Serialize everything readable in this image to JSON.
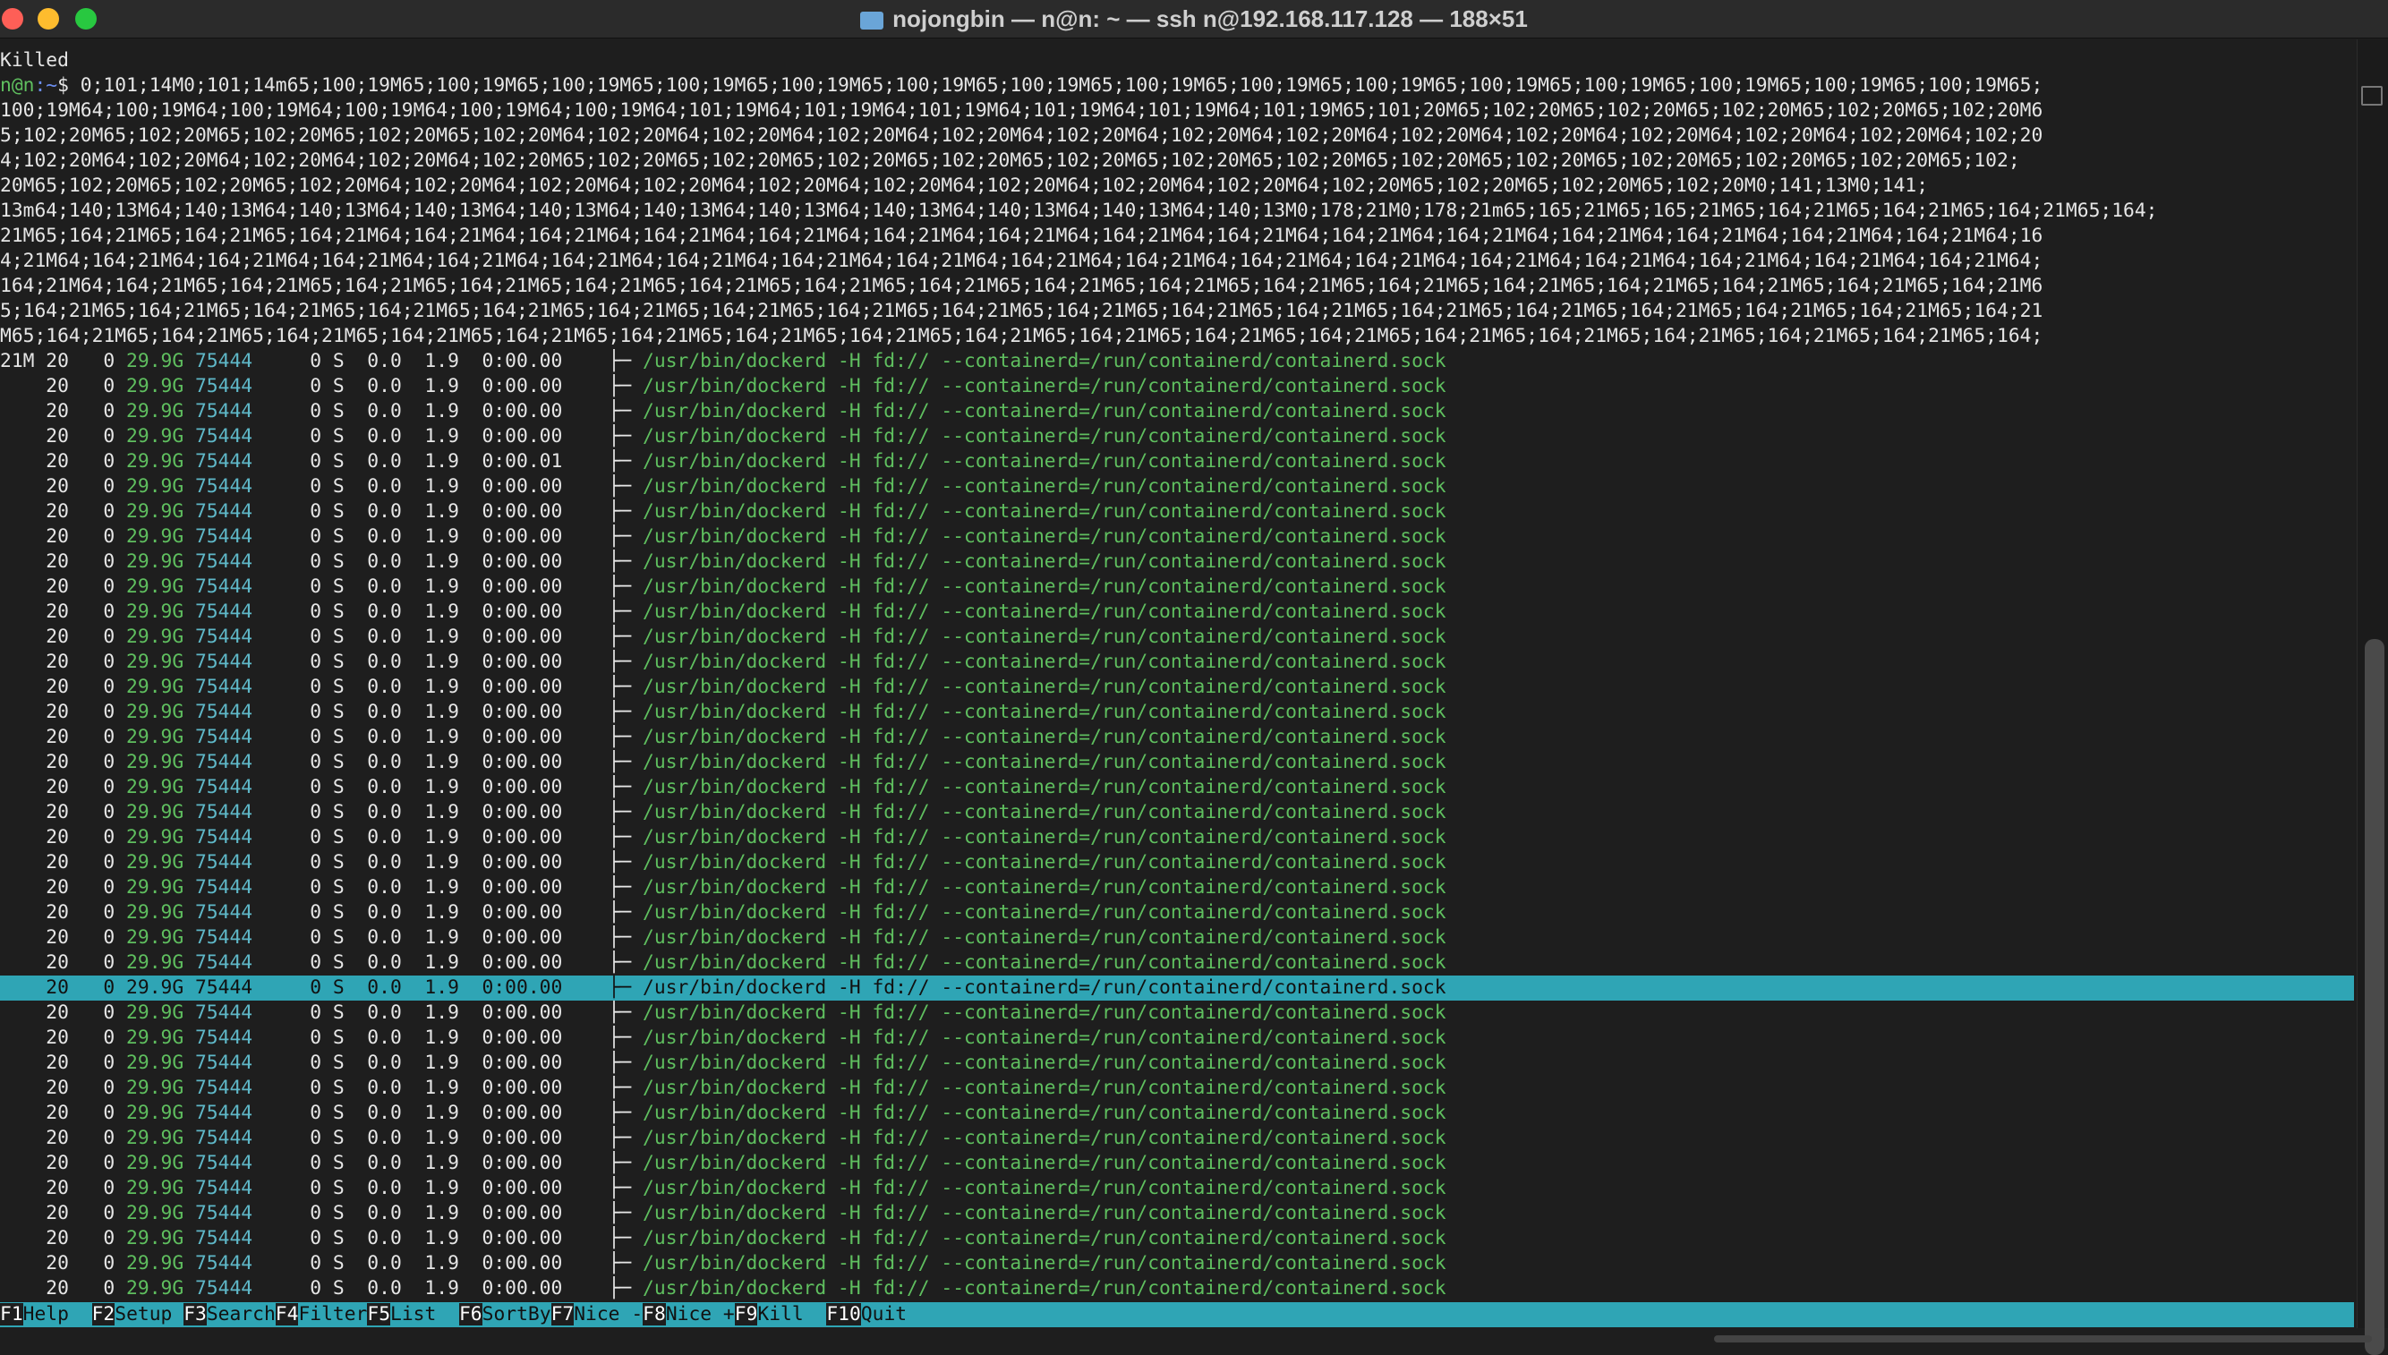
{
  "window": {
    "title": "nojongbin — n@n: ~ — ssh n@192.168.117.128 — 188×51"
  },
  "terminal": {
    "killed": "Killed",
    "prompt_user": "n@n",
    "prompt_path": ":~",
    "prompt_symbol": "$ ",
    "command_lines": [
      "0;101;14M0;101;14m65;100;19M65;100;19M65;100;19M65;100;19M65;100;19M65;100;19M65;100;19M65;100;19M65;100;19M65;100;19M65;100;19M65;100;19M65;100;19M65;100;19M65;100;19M65;",
      "100;19M64;100;19M64;100;19M64;100;19M64;100;19M64;100;19M64;101;19M64;101;19M64;101;19M64;101;19M64;101;19M64;101;19M65;101;20M65;102;20M65;102;20M65;102;20M65;102;20M65;102;20M6",
      "5;102;20M65;102;20M65;102;20M65;102;20M65;102;20M64;102;20M64;102;20M64;102;20M64;102;20M64;102;20M64;102;20M64;102;20M64;102;20M64;102;20M64;102;20M64;102;20M64;102;20M64;102;20",
      "4;102;20M64;102;20M64;102;20M64;102;20M64;102;20M65;102;20M65;102;20M65;102;20M65;102;20M65;102;20M65;102;20M65;102;20M65;102;20M65;102;20M65;102;20M65;102;20M65;102;20M65;102;",
      "20M65;102;20M65;102;20M65;102;20M64;102;20M64;102;20M64;102;20M64;102;20M64;102;20M64;102;20M64;102;20M64;102;20M64;102;20M65;102;20M65;102;20M65;102;20M0;141;13M0;141;",
      "13m64;140;13M64;140;13M64;140;13M64;140;13M64;140;13M64;140;13M64;140;13M64;140;13M64;140;13M64;140;13M64;140;13M0;178;21M0;178;21m65;165;21M65;165;21M65;164;21M65;164;21M65;164;21M65;164;",
      "21M65;164;21M65;164;21M65;164;21M64;164;21M64;164;21M64;164;21M64;164;21M64;164;21M64;164;21M64;164;21M64;164;21M64;164;21M64;164;21M64;164;21M64;164;21M64;164;21M64;164;21M64;16",
      "4;21M64;164;21M64;164;21M64;164;21M64;164;21M64;164;21M64;164;21M64;164;21M64;164;21M64;164;21M64;164;21M64;164;21M64;164;21M64;164;21M64;164;21M64;164;21M64;164;21M64;164;21M64;",
      "164;21M64;164;21M65;164;21M65;164;21M65;164;21M65;164;21M65;164;21M65;164;21M65;164;21M65;164;21M65;164;21M65;164;21M65;164;21M65;164;21M65;164;21M65;164;21M65;164;21M65;164;21M6",
      "5;164;21M65;164;21M65;164;21M65;164;21M65;164;21M65;164;21M65;164;21M65;164;21M65;164;21M65;164;21M65;164;21M65;164;21M65;164;21M65;164;21M65;164;21M65;164;21M65;164;21M65;164;21",
      "M65;164;21M65;164;21M65;164;21M65;164;21M65;164;21M65;164;21M65;164;21M65;164;21M65;164;21M65;164;21M65;164;21M65;164;21M65;164;21M65;164;21M65;164;21M65;164;21M65;164;21M65;164;"
    ],
    "first_row_prefix": "21M",
    "process": {
      "pri": "20",
      "ni": "0",
      "virt": "29.9G",
      "res": "75444",
      "shr": "0",
      "state": "S",
      "cpu": "0.0",
      "mem": "1.9",
      "time": "0:00.00",
      "time_alt": "0:00.01",
      "tree": "├─",
      "command": "/usr/bin/dockerd -H fd:// --containerd=/run/containerd/containerd.sock"
    },
    "selected_row_index": 25
  },
  "function_bar": [
    {
      "key": "F1",
      "label": "Help  "
    },
    {
      "key": "F2",
      "label": "Setup "
    },
    {
      "key": "F3",
      "label": "Search"
    },
    {
      "key": "F4",
      "label": "Filter"
    },
    {
      "key": "F5",
      "label": "List  "
    },
    {
      "key": "F6",
      "label": "SortBy"
    },
    {
      "key": "F7",
      "label": "Nice -"
    },
    {
      "key": "F8",
      "label": "Nice +"
    },
    {
      "key": "F9",
      "label": "Kill  "
    },
    {
      "key": "F10",
      "label": "Quit"
    }
  ]
}
